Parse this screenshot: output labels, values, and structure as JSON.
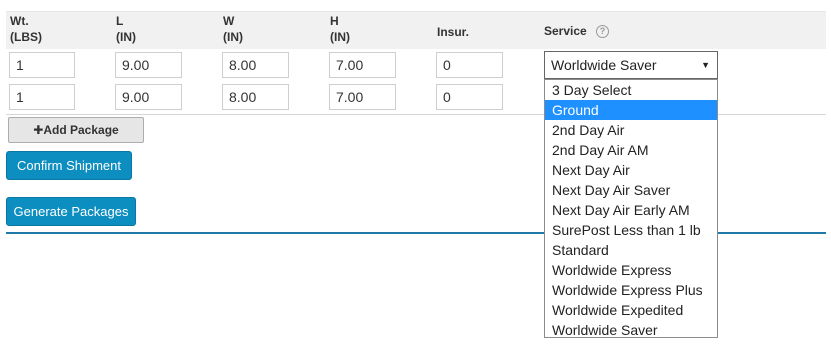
{
  "columns": {
    "wt": {
      "label": "Wt.",
      "unit": "(LBS)"
    },
    "l": {
      "label": "L",
      "unit": "(IN)"
    },
    "w": {
      "label": "W",
      "unit": "(IN)"
    },
    "h": {
      "label": "H",
      "unit": "(IN)"
    },
    "insur": {
      "label": "Insur."
    },
    "service": {
      "label": "Service",
      "help_icon": "question-circle-icon"
    }
  },
  "rows": [
    {
      "wt": "1",
      "l": "9.00",
      "w": "8.00",
      "h": "7.00",
      "insur": "0",
      "service": "Worldwide Saver"
    },
    {
      "wt": "1",
      "l": "9.00",
      "w": "8.00",
      "h": "7.00",
      "insur": "0"
    }
  ],
  "buttons": {
    "add_package": "Add Package",
    "confirm_shipment": "Confirm Shipment",
    "generate_packages": "Generate Packages"
  },
  "service_dropdown": {
    "selected_value": "Worldwide Saver",
    "highlighted": "Ground",
    "options": [
      "3 Day Select",
      "Ground",
      "2nd Day Air",
      "2nd Day Air AM",
      "Next Day Air",
      "Next Day Air Saver",
      "Next Day Air Early AM",
      "SurePost Less than 1 lb",
      "Standard",
      "Worldwide Express",
      "Worldwide Express Plus",
      "Worldwide Expedited",
      "Worldwide Saver"
    ]
  },
  "colors": {
    "primary_button": "#0d8ec0",
    "highlight": "#1e90ff",
    "rule": "#1f78a8"
  }
}
